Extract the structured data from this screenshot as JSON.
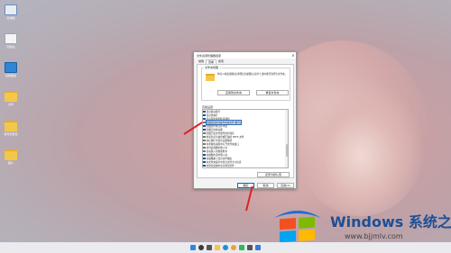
{
  "desktop": {
    "icons": [
      {
        "label": "此电脑",
        "icon": "this-pc-icon"
      },
      {
        "label": "回收站",
        "icon": "recycle-bin-icon"
      },
      {
        "label": "控制面板",
        "icon": "control-panel-icon"
      },
      {
        "label": "文件",
        "icon": "folder-icon"
      },
      {
        "label": "软件安装包",
        "icon": "folder-icon"
      },
      {
        "label": "图片",
        "icon": "folder-icon"
      }
    ]
  },
  "dialog": {
    "title": "文件资源管理器选项",
    "tabs": [
      "常规",
      "查看",
      "搜索"
    ],
    "active_tab": "查看",
    "folder_views": {
      "title": "文件夹视图",
      "description": "你可以将此视图(如详细信息或图标)应用于这种类型的所有文件夹。",
      "apply_button": "应用到文件夹",
      "reset_button": "重置文件夹"
    },
    "advanced": {
      "title": "高级设置:",
      "items": [
        {
          "text": "显示驱动器号",
          "checked": true
        },
        {
          "text": "显示状态栏",
          "checked": true
        },
        {
          "text": "显示同步提供程序通知",
          "checked": true
        },
        {
          "text": "隐藏受保护的操作系统文件(推荐)",
          "checked": false,
          "selected": true
        },
        {
          "text": "隐藏文件夹合并冲突",
          "checked": true
        },
        {
          "text": "隐藏空的驱动器",
          "checked": true
        },
        {
          "text": "隐藏已知文件类型的扩展名",
          "checked": false
        },
        {
          "text": "用彩色显示加密或压缩的 NTFS 文件",
          "checked": false
        },
        {
          "text": "在标题栏中显示完整路径",
          "checked": false
        },
        {
          "text": "在单独的进程中打开文件夹窗口",
          "checked": false
        },
        {
          "text": "在列表视图中键入时",
          "checked": false
        },
        {
          "text": "自动键入到搜索框中",
          "checked": false
        },
        {
          "text": "在视图中选中键入项",
          "checked": true
        },
        {
          "text": "在缩略图上显示文件图标",
          "checked": true
        },
        {
          "text": "在文件夹提示中显示文件大小信息",
          "checked": true
        },
        {
          "text": "在预览窗格中显示预览控件",
          "checked": true
        }
      ],
      "restore_button": "还原为默认值"
    },
    "footer": {
      "ok": "确定",
      "cancel": "取消",
      "apply": "应用(A)"
    }
  },
  "watermark": {
    "brand": "Windows 系统之家",
    "url": "www.bjjmlv.com"
  },
  "colors": {
    "accent": "#0067c0",
    "arrow": "#e02020"
  }
}
